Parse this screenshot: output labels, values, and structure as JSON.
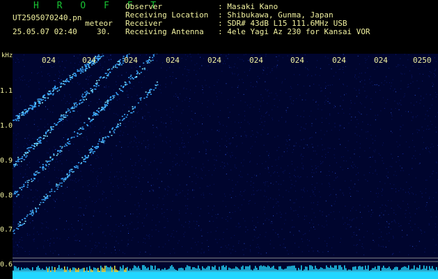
{
  "header": {
    "brand": "H R O F F T",
    "filename": "UT2505070240.pn",
    "tag": "meteor",
    "timestamp": "25.05.07 02:40",
    "seconds": "30.",
    "info": [
      {
        "label": "Observer",
        "sep": ":",
        "value": "Masaki Kano"
      },
      {
        "label": "Receiving Location",
        "sep": ":",
        "value": "Shibukawa, Gunma, Japan"
      },
      {
        "label": "Receiver",
        "sep": ":",
        "value": "SDR# 43dB L15 111.6MHz USB"
      },
      {
        "label": "Receiving Antenna",
        "sep": ":",
        "value": "4ele Yagi Az 230 for Kansai VOR"
      }
    ]
  },
  "spectrogram": {
    "unit": "kHz",
    "y_ticks": [
      "1.1",
      "1.0",
      "0.9",
      "0.8",
      "0.7",
      "0.6"
    ],
    "x_ticks": [
      "024",
      "024",
      "024",
      "024",
      "024",
      "024",
      "024",
      "024",
      "024",
      "0250"
    ],
    "background_color": "#00052e",
    "trace_color": "#3aa8ff",
    "baseline_color": "#22d6ff",
    "meteor_traces": 4
  }
}
